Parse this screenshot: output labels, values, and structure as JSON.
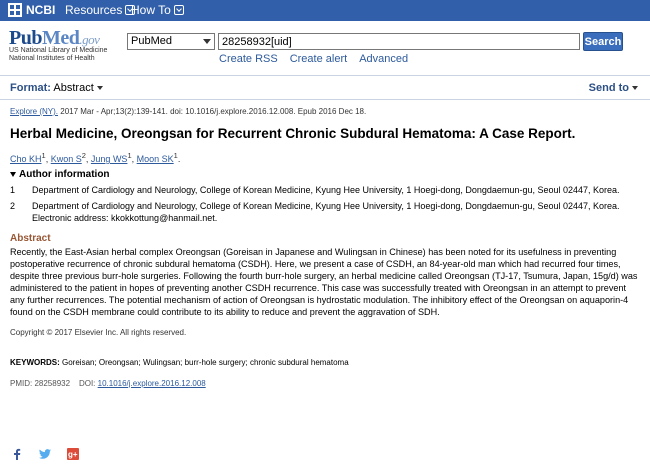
{
  "topbar": {
    "ncbi": "NCBI",
    "resources": "Resources",
    "howto": "How To"
  },
  "header": {
    "logo_pub": "Pub",
    "logo_med": "Med",
    "logo_gov": ".gov",
    "nlm_line1": "US National Library of Medicine",
    "nlm_line2": "National Institutes of Health",
    "db_selected": "PubMed",
    "search_value": "28258932[uid]",
    "search_button": "Search",
    "links": [
      "Create RSS",
      "Create alert",
      "Advanced"
    ]
  },
  "formatbar": {
    "format_label": "Format:",
    "format_value": "Abstract",
    "send_to": "Send to"
  },
  "article": {
    "journal": "Explore (NY).",
    "citation": " 2017 Mar - Apr;13(2):139-141. doi: 10.1016/j.explore.2016.12.008. Epub 2016 Dec 18.",
    "title": "Herbal Medicine, Oreongsan for Recurrent Chronic Subdural Hematoma: A Case Report.",
    "authors": [
      {
        "name": "Cho KH",
        "sup": "1"
      },
      {
        "name": "Kwon S",
        "sup": "2"
      },
      {
        "name": "Jung WS",
        "sup": "1"
      },
      {
        "name": "Moon SK",
        "sup": "1"
      }
    ],
    "author_info_label": "Author information",
    "affiliations": [
      {
        "n": "1",
        "text": "Department of Cardiology and Neurology, College of Korean Medicine, Kyung Hee University, 1 Hoegi-dong, Dongdaemun-gu, Seoul 02447, Korea."
      },
      {
        "n": "2",
        "text": "Department of Cardiology and Neurology, College of Korean Medicine, Kyung Hee University, 1 Hoegi-dong, Dongdaemun-gu, Seoul 02447, Korea. Electronic address: kkokkottung@hanmail.net."
      }
    ],
    "abstract_label": "Abstract",
    "abstract": "Recently, the East-Asian herbal complex Oreongsan (Goreisan in Japanese and Wulingsan in Chinese) has been noted for its usefulness in preventing postoperative recurrence of chronic subdural hematoma (CSDH). Here, we present a case of CSDH, an 84-year-old man which had recurred four times, despite three previous burr-hole surgeries. Following the fourth burr-hole surgery, an herbal medicine called Oreongsan (TJ-17, Tsumura, Japan, 15g/d) was administered to the patient in hopes of preventing another CSDH recurrence. This case was successfully treated with Oreongsan in an attempt to prevent any further recurrences. The potential mechanism of action of Oreongsan is hydrostatic modulation. The inhibitory effect of the Oreongsan on aquaporin-4 found on the CSDH membrane could contribute to its ability to reduce and prevent the aggravation of SDH.",
    "copyright": "Copyright © 2017 Elsevier Inc. All rights reserved.",
    "keywords_label": "KEYWORDS:",
    "keywords": " Goreisan; Oreongsan; Wulingsan; burr-hole surgery; chronic subdural hematoma",
    "pmid": "PMID: 28258932",
    "doi_label": "DOI:",
    "doi": "10.1016/j.explore.2016.12.008"
  },
  "colors": {
    "topbar": "#315fa9",
    "link": "#2d5a9c",
    "abstract_heading": "#985735"
  }
}
